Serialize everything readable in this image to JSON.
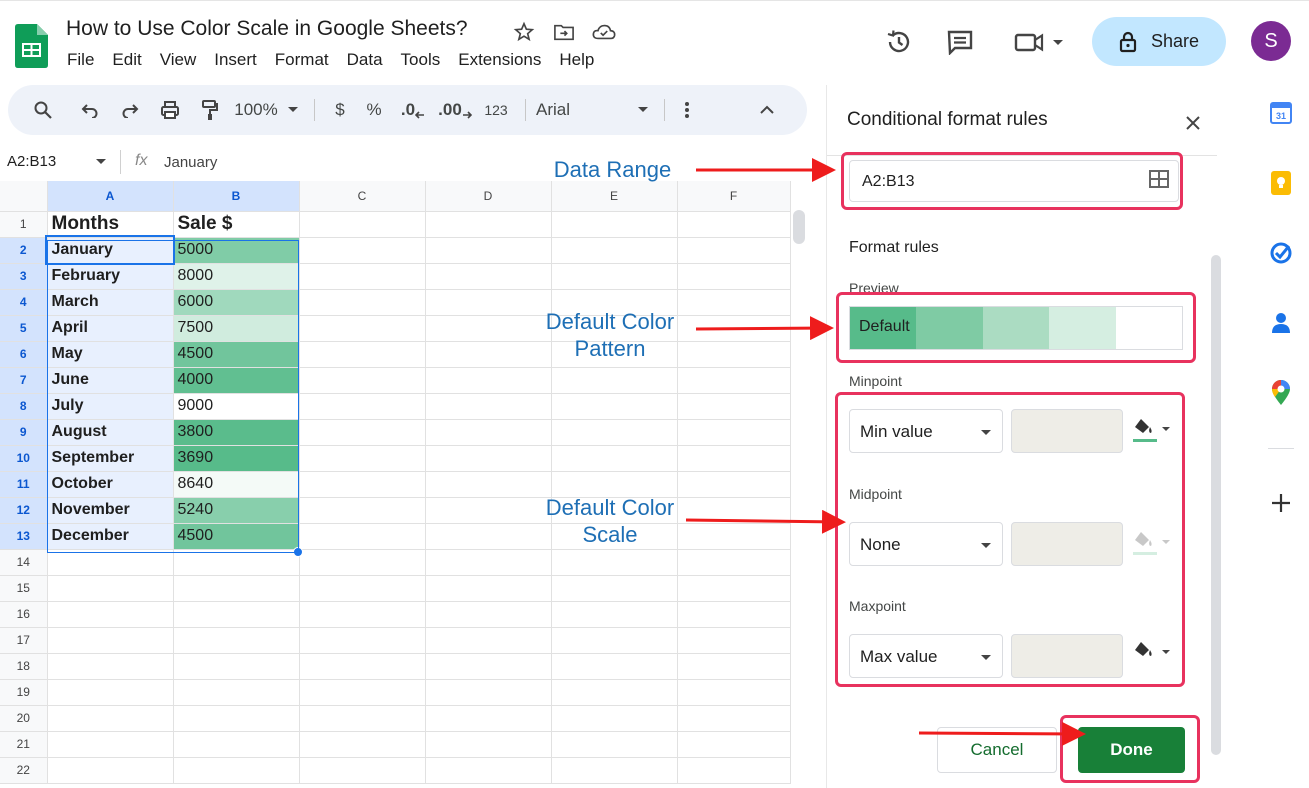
{
  "header": {
    "title": "How to Use Color Scale in Google Sheets?",
    "menu": [
      "File",
      "Edit",
      "View",
      "Insert",
      "Format",
      "Data",
      "Tools",
      "Extensions",
      "Help"
    ],
    "share_label": "Share",
    "avatar_initial": "S"
  },
  "toolbar": {
    "zoom": "100%",
    "currency": "$",
    "percent": "%",
    "dec_decrease": ".0",
    "dec_increase": ".00",
    "number_format": "123",
    "font": "Arial"
  },
  "formula_bar": {
    "name_box": "A2:B13",
    "fx": "fx",
    "value": "January"
  },
  "sheet": {
    "columns": [
      "A",
      "B",
      "C",
      "D",
      "E",
      "F"
    ],
    "header_row": {
      "a": "Months",
      "b": "Sale $"
    },
    "rows": [
      {
        "num": "2",
        "month": "January",
        "sale": "5000"
      },
      {
        "num": "3",
        "month": "February",
        "sale": "8000"
      },
      {
        "num": "4",
        "month": "March",
        "sale": "6000"
      },
      {
        "num": "5",
        "month": "April",
        "sale": "7500"
      },
      {
        "num": "6",
        "month": "May",
        "sale": "4500"
      },
      {
        "num": "7",
        "month": "June",
        "sale": "4000"
      },
      {
        "num": "8",
        "month": "July",
        "sale": "9000"
      },
      {
        "num": "9",
        "month": "August",
        "sale": "3800"
      },
      {
        "num": "10",
        "month": "September",
        "sale": "3690"
      },
      {
        "num": "11",
        "month": "October",
        "sale": "8640"
      },
      {
        "num": "12",
        "month": "November",
        "sale": "5240"
      },
      {
        "num": "13",
        "month": "December",
        "sale": "4500"
      }
    ],
    "empty_rows": [
      "14",
      "15",
      "16",
      "17",
      "18",
      "19",
      "20",
      "21",
      "22"
    ],
    "scale_min_color": "#57bb8a",
    "scale_max_color": "#ffffff"
  },
  "panel": {
    "title": "Conditional format rules",
    "range": "A2:B13",
    "format_rules_label": "Format rules",
    "preview_label": "Preview",
    "preview_text": "Default",
    "preview_colors": [
      "#57bb8a",
      "#7fcba4",
      "#abdcc2",
      "#d5eee1",
      "#ffffff"
    ],
    "minpoint_label": "Minpoint",
    "minpoint_value": "Min value",
    "midpoint_label": "Midpoint",
    "midpoint_value": "None",
    "maxpoint_label": "Maxpoint",
    "maxpoint_value": "Max value",
    "cancel_label": "Cancel",
    "done_label": "Done"
  },
  "annotations": {
    "data_range": "Data Range",
    "color_pattern_line1": "Default Color",
    "color_pattern_line2": "Pattern",
    "color_scale_line1": "Default Color",
    "color_scale_line2": "Scale"
  }
}
